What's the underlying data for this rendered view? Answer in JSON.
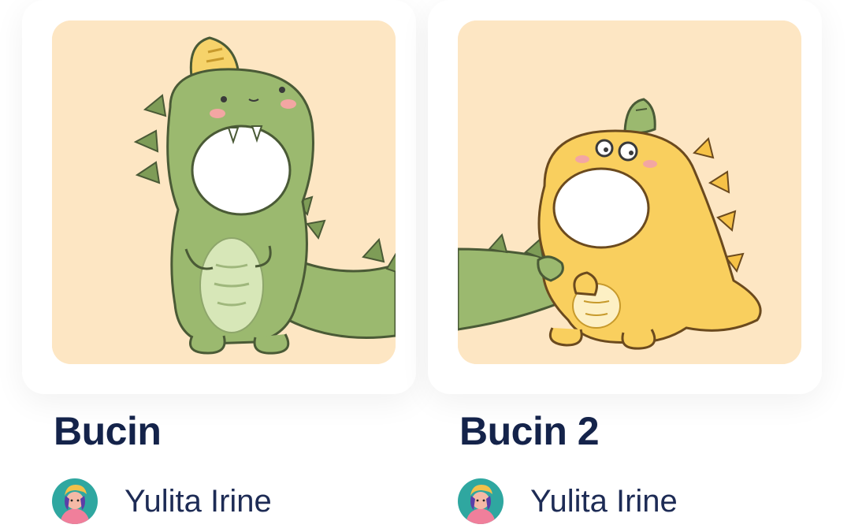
{
  "cards": [
    {
      "title": "Bucin",
      "author": "Yulita Irine",
      "cover_icon": "green-dinosaur-illustration",
      "avatar_icon": "author-avatar"
    },
    {
      "title": "Bucin 2",
      "author": "Yulita Irine",
      "cover_icon": "yellow-dinosaur-illustration",
      "avatar_icon": "author-avatar"
    }
  ],
  "colors": {
    "cover_background": "#fde6c3",
    "title_text": "#14234a",
    "author_text": "#1d2b55",
    "green_dino": "#9bb96f",
    "yellow_dino": "#f9cf5e",
    "avatar_background": "#2fa7a0"
  }
}
